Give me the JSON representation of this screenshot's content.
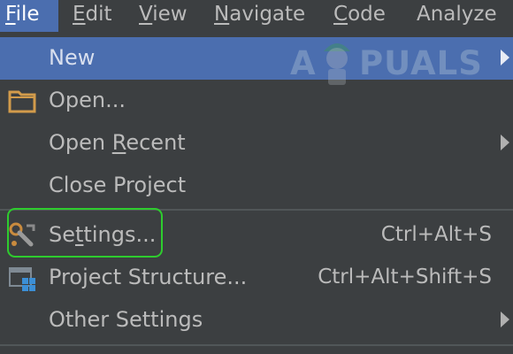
{
  "menubar": {
    "items": [
      {
        "label": "File",
        "mnemonic_index": 0,
        "active": true
      },
      {
        "label": "Edit",
        "mnemonic_index": 0,
        "active": false
      },
      {
        "label": "View",
        "mnemonic_index": 0,
        "active": false
      },
      {
        "label": "Navigate",
        "mnemonic_index": 0,
        "active": false
      },
      {
        "label": "Code",
        "mnemonic_index": 0,
        "active": false
      },
      {
        "label": "Analyze",
        "mnemonic_index": -1,
        "active": false
      }
    ]
  },
  "file_menu": {
    "items": [
      {
        "label": "New",
        "shortcut": "",
        "submenu": true,
        "selected": true,
        "icon": ""
      },
      {
        "label": "Open...",
        "shortcut": "",
        "submenu": false,
        "selected": false,
        "icon": "folder-icon"
      },
      {
        "label": "Open Recent",
        "shortcut": "",
        "submenu": true,
        "selected": false,
        "icon": "",
        "mnemonic_index": 5
      },
      {
        "label": "Close Project",
        "shortcut": "",
        "submenu": false,
        "selected": false,
        "icon": ""
      },
      {
        "label": "Settings...",
        "shortcut": "Ctrl+Alt+S",
        "submenu": false,
        "selected": false,
        "icon": "wrench-icon",
        "mnemonic_index": 2,
        "highlighted": true
      },
      {
        "label": "Project Structure...",
        "shortcut": "Ctrl+Alt+Shift+S",
        "submenu": false,
        "selected": false,
        "icon": "project-structure-icon"
      },
      {
        "label": "Other Settings",
        "shortcut": "",
        "submenu": true,
        "selected": false,
        "icon": ""
      }
    ]
  },
  "watermark": {
    "left": "A",
    "right": "PUALS"
  },
  "colors": {
    "menu_background": "#3c3f41",
    "selection": "#4b6eaf",
    "text": "#bbbbbb",
    "highlight_outline": "#2ecc2e",
    "folder_icon": "#d29b4b",
    "project_structure_icon": "#3c8fd6"
  }
}
